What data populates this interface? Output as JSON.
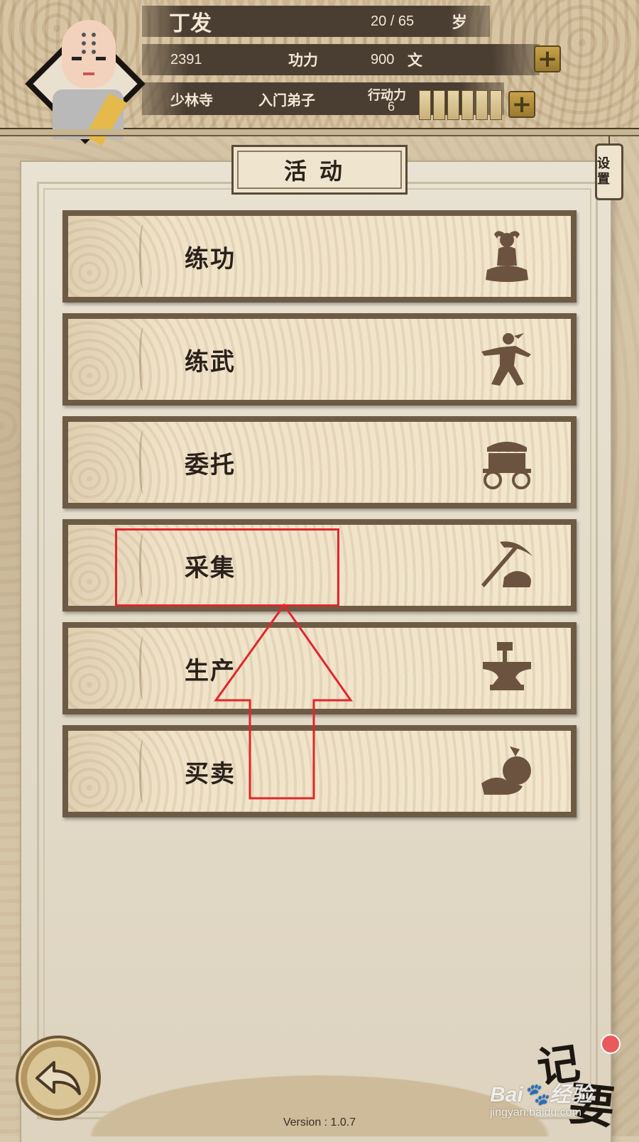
{
  "header": {
    "name": "丁发",
    "age": "20 / 65",
    "age_unit": "岁",
    "gongli_value": "2391",
    "gongli_label": "功力",
    "money": "900",
    "money_unit": "文",
    "sect": "少林寺",
    "rank": "入门弟子",
    "action_label": "行动力",
    "action_value": "6",
    "action_segments": 6
  },
  "panel": {
    "title": "活动",
    "settings_label": "设置"
  },
  "menu": [
    {
      "label": "练功",
      "icon": "meditation-icon"
    },
    {
      "label": "练武",
      "icon": "martial-stance-icon"
    },
    {
      "label": "委托",
      "icon": "cart-icon"
    },
    {
      "label": "采集",
      "icon": "pickaxe-icon"
    },
    {
      "label": "生产",
      "icon": "anvil-icon"
    },
    {
      "label": "买卖",
      "icon": "money-bag-icon"
    }
  ],
  "bottom": {
    "back_icon": "back-arrow-icon",
    "memo_char1": "记",
    "memo_char2": "要",
    "watermark_line1": "Bai",
    "watermark_line1b": "经验",
    "watermark_line2": "jingyan.baidu.com",
    "version": "Version : 1.0.7"
  },
  "colors": {
    "annotation": "#e0262b",
    "strip": "#4a3d31",
    "gold": "#c8a24a"
  }
}
